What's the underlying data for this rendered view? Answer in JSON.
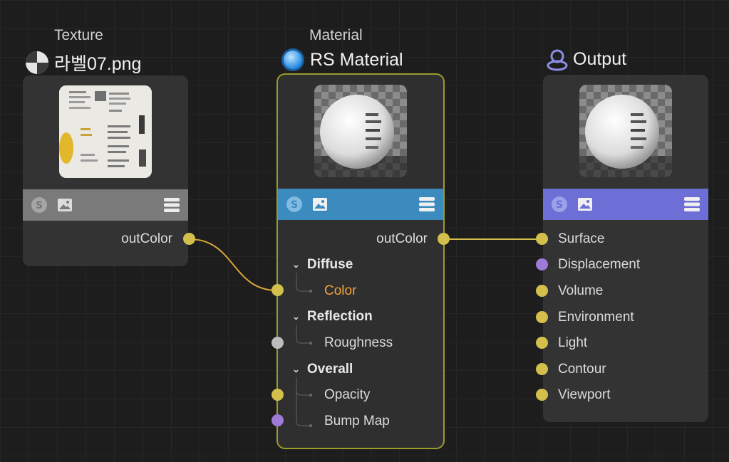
{
  "colors": {
    "texture_bar": "#7a7a7a",
    "material_bar": "#3b8bbf",
    "output_bar": "#6d6fd6",
    "port_yellow": "#d3c04c",
    "port_purple": "#a07ad8",
    "port_grey": "#bdbdbd",
    "wire": "#d6a43a",
    "accent_label": "#f2a33c"
  },
  "texture_node": {
    "type": "Texture",
    "title": "라벨07.png",
    "icon": "texture-sphere-icon",
    "output_port": "outColor"
  },
  "material_node": {
    "type": "Material",
    "title": "RS Material",
    "icon": "material-sphere-icon",
    "output_port": "outColor",
    "sections": [
      {
        "label": "Diffuse",
        "inputs": [
          "Color"
        ]
      },
      {
        "label": "Reflection",
        "inputs": [
          "Roughness"
        ]
      },
      {
        "label": "Overall",
        "inputs": [
          "Opacity",
          "Bump Map"
        ]
      }
    ]
  },
  "output_node": {
    "title": "Output",
    "icon": "output-icon",
    "inputs": [
      "Surface",
      "Displacement",
      "Volume",
      "Environment",
      "Light",
      "Contour",
      "Viewport"
    ]
  },
  "toolbar_icons": [
    "solo-icon",
    "image-preview-icon",
    "menu-icon"
  ]
}
